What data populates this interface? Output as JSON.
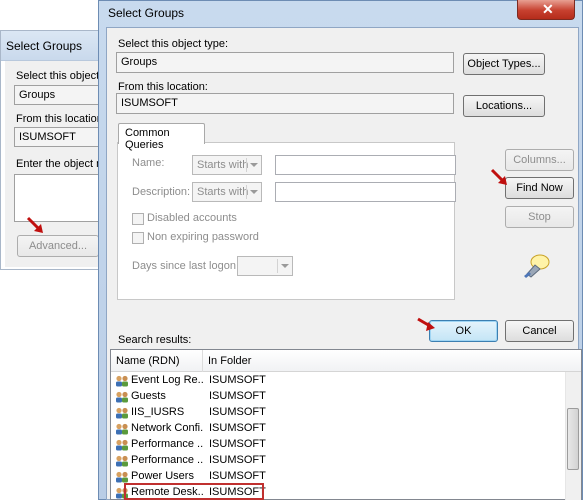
{
  "back_dialog": {
    "title": "Select Groups",
    "object_type_label": "Select this object typ",
    "object_type_value": "Groups",
    "location_label": "From this location:",
    "location_value": "ISUMSOFT",
    "enter_names_label": "Enter the object nam",
    "advanced_button": "Advanced..."
  },
  "dialog": {
    "title": "Select Groups",
    "object_type_label": "Select this object type:",
    "object_type_value": "Groups",
    "object_types_button": "Object Types...",
    "location_label": "From this location:",
    "location_value": "ISUMSOFT",
    "locations_button": "Locations...",
    "tab_label": "Common Queries",
    "name_label": "Name:",
    "name_mode": "Starts with",
    "description_label": "Description:",
    "description_mode": "Starts with",
    "disabled_accounts_label": "Disabled accounts",
    "non_expiring_label": "Non expiring password",
    "days_since_label": "Days since last logon:",
    "columns_button": "Columns...",
    "find_now_button": "Find Now",
    "stop_button": "Stop",
    "ok_button": "OK",
    "cancel_button": "Cancel",
    "search_results_label": "Search results:"
  },
  "results": {
    "columns": [
      "Name (RDN)",
      "In Folder"
    ],
    "rows": [
      {
        "name": "Event Log Re...",
        "folder": "ISUMSOFT"
      },
      {
        "name": "Guests",
        "folder": "ISUMSOFT"
      },
      {
        "name": "IIS_IUSRS",
        "folder": "ISUMSOFT"
      },
      {
        "name": "Network Confi...",
        "folder": "ISUMSOFT"
      },
      {
        "name": "Performance ...",
        "folder": "ISUMSOFT"
      },
      {
        "name": "Performance ...",
        "folder": "ISUMSOFT"
      },
      {
        "name": "Power Users",
        "folder": "ISUMSOFT"
      },
      {
        "name": "Remote Desk...",
        "folder": "ISUMSOFT"
      }
    ],
    "highlighted_row": "Remote Desk..."
  },
  "colors": {
    "title_bar": "#c8daee",
    "close_button": "#c7402f",
    "highlight_box": "#c0302f",
    "annotation_arrow": "#c0100f",
    "default_button": "#c4e5f6"
  },
  "icons": {
    "group_icon": "group-icon",
    "search_icon": "search-flashlight-icon",
    "close_icon": "close-icon",
    "arrow_icon": "red-pointer-arrow-icon"
  }
}
